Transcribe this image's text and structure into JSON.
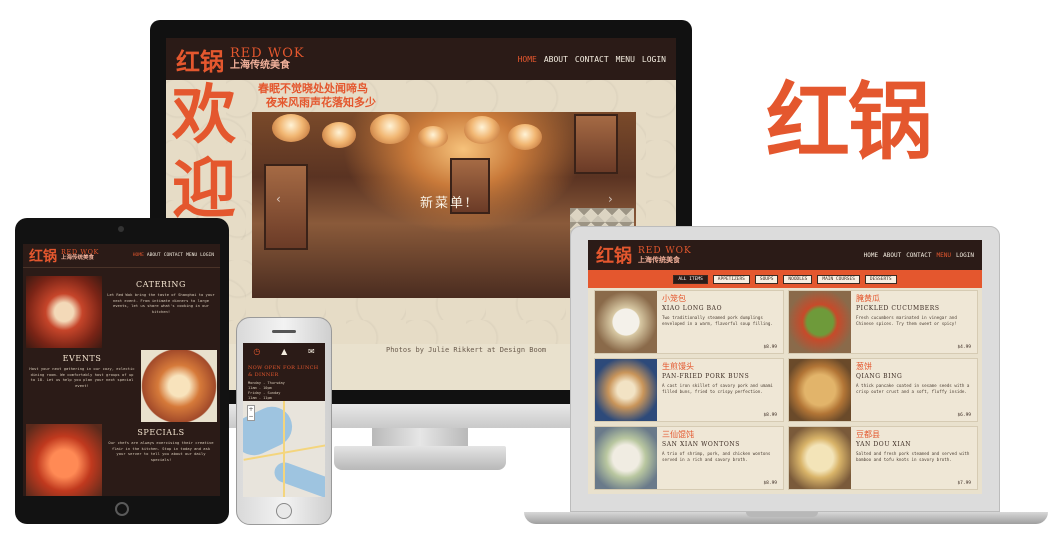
{
  "brand": {
    "logo_cn": "红锅",
    "name_en": "RED WOK",
    "tagline_cn": "上海传统美食"
  },
  "nav": {
    "links": [
      "HOME",
      "ABOUT",
      "CONTACT",
      "MENU",
      "LOGIN"
    ],
    "desktop_active": "HOME",
    "laptop_active": "MENU",
    "tablet_active": "HOME"
  },
  "hero": {
    "welcome_cn": [
      "欢",
      "迎"
    ],
    "slogan_cn": [
      "春眠不觉晓处处闻啼鸟",
      "夜来风雨声花落知多少"
    ],
    "caption_cn": "新菜单!",
    "photo_credit": "Photos by Julie Rikkert at Design Boom"
  },
  "menu": {
    "filters": [
      "ALL ITEMS",
      "APPETIZERS",
      "SOUPS",
      "NOODLES",
      "MAIN COURSES",
      "DESSERTS"
    ],
    "active_filter": "ALL ITEMS",
    "items": [
      {
        "cn": "小笼包",
        "en": "XIAO LONG BAO",
        "desc": "Two traditionally steamed pork dumplings enveloped in a warm, flavorful soup filling.",
        "price": "$8.99"
      },
      {
        "cn": "腌黄瓜",
        "en": "PICKLED CUCUMBERS",
        "desc": "Fresh cucumbers marinated in vinegar and Chinese spices. Try them sweet or spicy!",
        "price": "$4.99"
      },
      {
        "cn": "生煎馒头",
        "en": "PAN-FRIED PORK BUNS",
        "desc": "A cast iron skillet of savory pork and umami filled buns, fried to crispy perfection.",
        "price": "$8.99"
      },
      {
        "cn": "葱饼",
        "en": "QIANG BING",
        "desc": "A thick pancake coated in sesame seeds with a crisp outer crust and a soft, fluffy inside.",
        "price": "$6.99"
      },
      {
        "cn": "三仙馄饨",
        "en": "SAN XIAN WONTONS",
        "desc": "A trio of shrimp, pork, and chicken wontons served in a rich and savory broth.",
        "price": "$8.99"
      },
      {
        "cn": "豆都县",
        "en": "YAN DOU XIAN",
        "desc": "Salted and fresh pork steamed and served with bamboo and tofu knots in savory broth.",
        "price": "$7.99"
      }
    ]
  },
  "tablet": {
    "sections": [
      {
        "title": "CATERING",
        "text": "Let Red Wok bring the taste of Shanghai to your next event. From intimate dinners to large events, let us share what's cooking in our kitchen!"
      },
      {
        "title": "EVENTS",
        "text": "Host your next gathering in our cozy, eclectic dining room. We comfortably host groups of up to 18. Let us help you plan your next special event!"
      },
      {
        "title": "SPECIALS",
        "text": "Our chefs are always exercising their creative flair in the kitchen. Stop in today and ask your server to tell you about our daily specials!"
      }
    ]
  },
  "phone": {
    "heading": "NOW OPEN FOR LUNCH & DINNER",
    "hours": [
      "Monday - Thursday",
      "11am - 10pm",
      "Friday - Sunday",
      "11am - 11pm"
    ],
    "icons": [
      "clock-icon",
      "building-icon",
      "mail-icon"
    ]
  },
  "colors": {
    "accent": "#e4572e",
    "dark": "#2b1b17",
    "cream": "#e9e1cd"
  }
}
